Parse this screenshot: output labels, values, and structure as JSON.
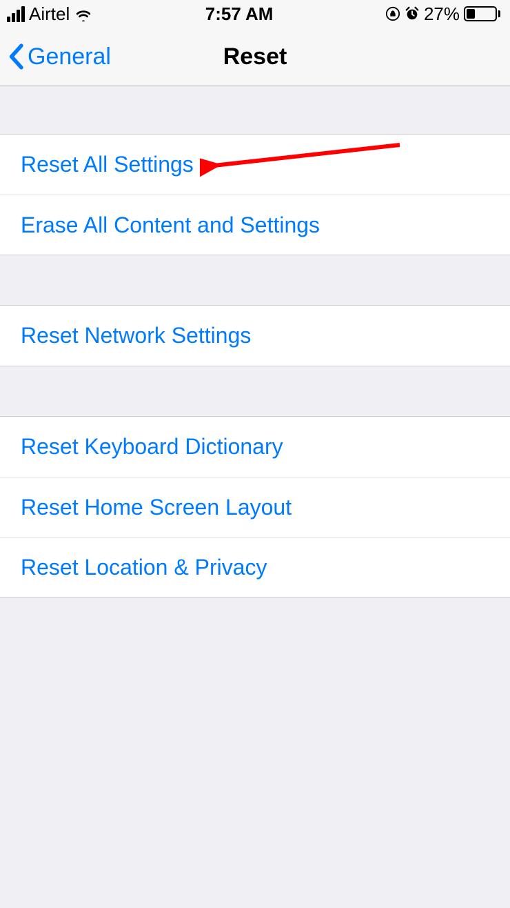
{
  "status": {
    "carrier": "Airtel",
    "time": "7:57 AM",
    "battery_percent": "27%"
  },
  "nav": {
    "back_label": "General",
    "title": "Reset"
  },
  "groups": {
    "g1": {
      "reset_all": "Reset All Settings",
      "erase_all": "Erase All Content and Settings"
    },
    "g2": {
      "reset_network": "Reset Network Settings"
    },
    "g3": {
      "reset_keyboard": "Reset Keyboard Dictionary",
      "reset_home": "Reset Home Screen Layout",
      "reset_location": "Reset Location & Privacy"
    }
  }
}
